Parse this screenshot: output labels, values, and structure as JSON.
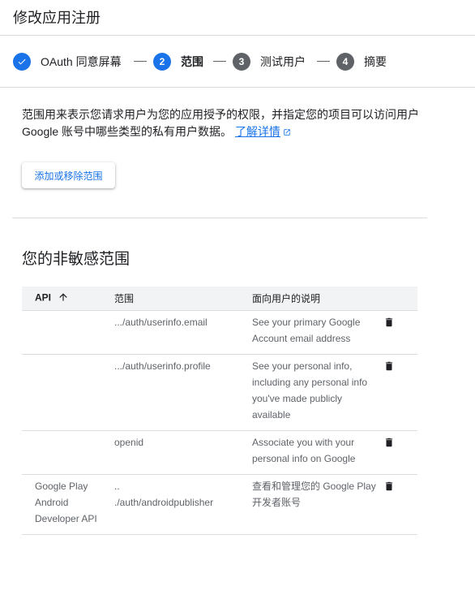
{
  "header": {
    "title": "修改应用注册"
  },
  "stepper": {
    "steps": [
      {
        "number": "",
        "label": "OAuth 同意屏幕"
      },
      {
        "number": "2",
        "label": "范围"
      },
      {
        "number": "3",
        "label": "测试用户"
      },
      {
        "number": "4",
        "label": "摘要"
      }
    ]
  },
  "description": {
    "text": "范围用来表示您请求用户为您的应用授予的权限，并指定您的项目可以访问用户 Google 账号中哪些类型的私有用户数据。",
    "link": "了解详情"
  },
  "add_button": {
    "label": "添加或移除范围"
  },
  "section": {
    "title": "您的非敏感范围"
  },
  "table": {
    "columns": {
      "api": "API",
      "scope": "范围",
      "desc": "面向用户的说明"
    },
    "rows": [
      {
        "api": "",
        "scope": ".../auth/userinfo.email",
        "desc": "See your primary Google Account email address"
      },
      {
        "api": "",
        "scope": ".../auth/userinfo.profile",
        "desc": "See your personal info, including any personal info you've made publicly available"
      },
      {
        "api": "",
        "scope": "openid",
        "desc": "Associate you with your personal info on Google"
      },
      {
        "api": "Google Play Android Developer API",
        "scope": "..\n./auth/androidpublisher",
        "desc": "查看和管理您的 Google Play 开发者账号"
      }
    ]
  },
  "colors": {
    "accent": "#1a73e8",
    "pending": "#5f6368",
    "divider": "#dadce0",
    "table_header_bg": "#f1f3f4"
  },
  "icons": {
    "step_done": "check-icon",
    "sort": "arrow-up-icon",
    "delete": "trash-icon",
    "external": "open-in-new-icon"
  }
}
